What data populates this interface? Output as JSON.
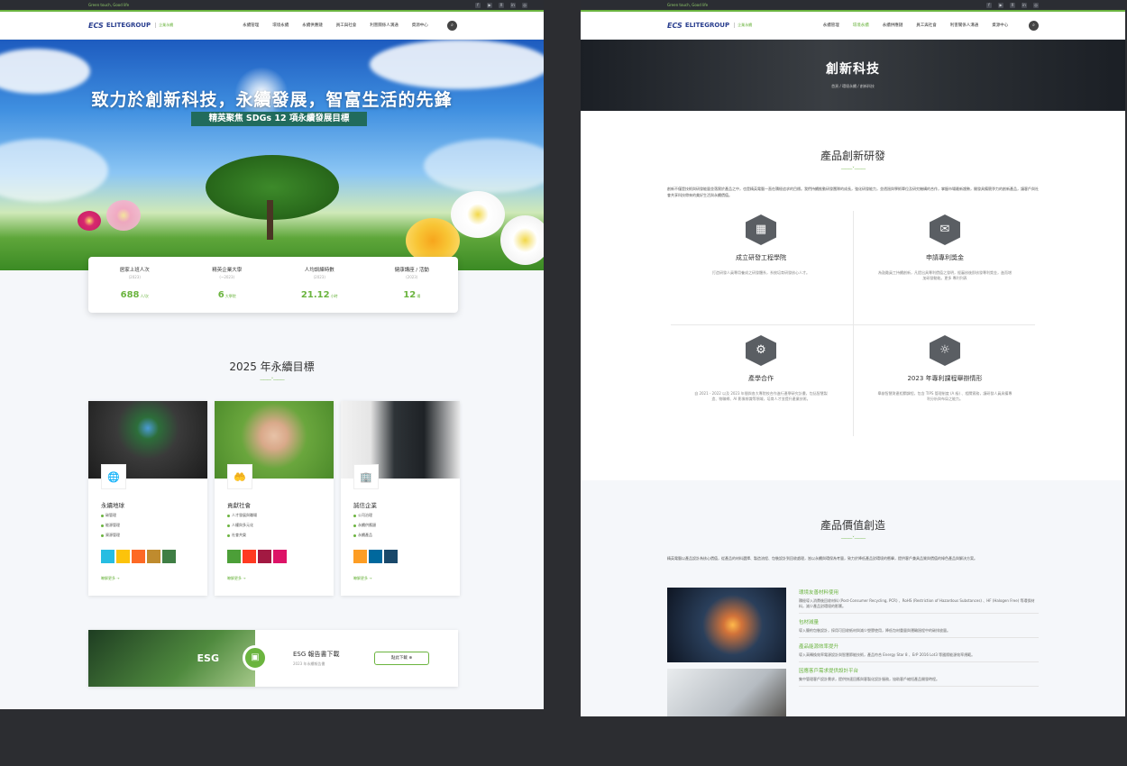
{
  "site": {
    "tagline": "Green touch, Good life",
    "logo_mark": "ECS",
    "logo_text": "ELITEGROUP",
    "logo_sub": "企業永續",
    "social_icons": [
      "facebook-icon",
      "youtube-icon",
      "x-icon",
      "linkedin-icon",
      "instagram-icon"
    ],
    "social_glyphs": [
      "f",
      "▶",
      "X",
      "in",
      "◎"
    ],
    "menu": [
      "永續管理",
      "環境永續",
      "永續供應鏈",
      "員工與社會",
      "利害關係人溝通",
      "資源中心"
    ],
    "accent_color": "#6bb43f"
  },
  "left": {
    "hero_title": "致力於創新科技，永續發展，智富生活的先鋒",
    "hero_sub": "精英聚焦 SDGs 12 項永續發展目標",
    "stats": [
      {
        "label": "居家上班人次",
        "year": "(2023)",
        "num": "688",
        "unit": "人/次"
      },
      {
        "label": "精英企業大學",
        "year": "(~2023)",
        "num": "6",
        "unit": "大學院"
      },
      {
        "label": "人均訓練時數",
        "year": "(2023)",
        "num": "21.12",
        "unit": "小時"
      },
      {
        "label": "健康講座 / 活動",
        "year": "(2023)",
        "num": "12",
        "unit": "場"
      }
    ],
    "goals_title": "2025 年永續目標",
    "goals": [
      {
        "title": "永續地球",
        "icon": "🌐",
        "items": [
          "碳管理",
          "能源管理",
          "資源管理"
        ],
        "more": "瞭解更多 →",
        "sdg_colors": [
          "#26bde2",
          "#fcc30b",
          "#fd6925",
          "#bf8b2e",
          "#3f7e44"
        ]
      },
      {
        "title": "貢獻社會",
        "icon": "🤲",
        "items": [
          "人才發展與職場",
          "人權與多元化",
          "社會共榮"
        ],
        "more": "瞭解更多 →",
        "sdg_colors": [
          "#4c9f38",
          "#ff3a21",
          "#a21942",
          "#dd1367"
        ]
      },
      {
        "title": "誠信企業",
        "icon": "🏢",
        "items": [
          "公司治理",
          "永續供應鏈",
          "永續產品"
        ],
        "more": "瞭解更多 →",
        "sdg_colors": [
          "#fd9d24",
          "#00689d",
          "#19486a"
        ]
      }
    ],
    "esg_title": "ESG 報告書下載",
    "esg_sub": "2023 年永續報告書",
    "esg_word": "ESG",
    "esg_button": "點此下載 ⊕"
  },
  "right": {
    "active_menu": "環境永續",
    "banner_title": "創新科技",
    "breadcrumb": "首頁 / 環境永續 / 創新科技",
    "sec1_title": "產品創新研發",
    "sec1_intro": "創新不僅是技術與研發能量並落實於產品之中，也是精英電腦一直在積極追求的目標。我們持續推動研發團隊的成長，強化研發能力，並透過與學術單位及研究機構的合作，掌握市場最新趨勢，開發具備競爭力的創新產品，讓客戶與社會共享科技帶來的美好生活與永續價值。",
    "innovations": [
      {
        "title": "成立研發工程學院",
        "icon": "▦",
        "desc": "打造研發人員專用養成之研發體系，系統培育研發核心人才。"
      },
      {
        "title": "申請專利獎金",
        "icon": "✉",
        "desc": "為鼓勵員工持續創新，凡提出具專利價值之發明，經審核後即核發專利獎金，進而增加研發動能。更多 專利列表"
      },
      {
        "title": "產學合作",
        "icon": "⚙",
        "desc": "自 2021 - 2022 以及 2023 年間與各大專院校合作進行產學研究計畫，包括智慧製造、物聯網、AI 影像辨識等領域，培育人才並提升產業技術。"
      },
      {
        "title": "2023 年專利課程舉辦情形",
        "icon": "☼",
        "desc": "舉辦智慧財產相關課程，包含 TIPS 管理制度 (A 級) 、相關實務，讓研發人員具備專利分析與布局之能力。"
      }
    ],
    "sec2_title": "產品價值創造",
    "sec2_intro": "精英電腦以產品設計為核心價值，從產品的材料選擇、製造流程、包裝設計到回收處理，皆以永續與環保為考量，致力於降低產品對環境的衝擊，提供客戶兼具品質與價值的綠色產品與解決方案。",
    "values": [
      {
        "title": "環境友善材料使用",
        "desc": "積極導入消費後回收材料 (Post-Consumer Recycling, PCR) 、RoHS (Restriction of Hazardous Substances) 、HF (Halogen Free) 等環保材料，減少產品對環境的影響。"
      },
      {
        "title": "包材減量",
        "desc": "導入簡約包裝設計，採用可回收紙材與減少塑膠使用，降低包材重量與運輸過程中的碳排放量。"
      },
      {
        "title": "產品能源效率提升",
        "desc": "導入高轉換效率電源設計與智慧節能技術，產品符合 Energy Star 8 、ErP 2016 Lot3 等國際能源效率規範。"
      },
      {
        "title": "因應客戶需求提供設計平台",
        "desc": "集中管理客戶設計需求，提供快速回應與客製化設計服務，協助客戶縮短產品開發時程。"
      }
    ]
  }
}
